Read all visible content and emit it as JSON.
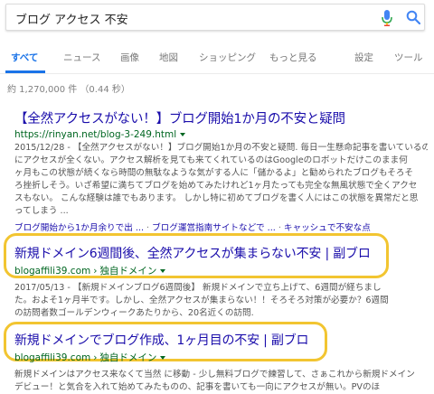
{
  "search": {
    "query": "ブログ アクセス 不安"
  },
  "tabs": [
    {
      "label": "すべて",
      "active": true
    },
    {
      "label": "ニュース"
    },
    {
      "label": "画像"
    },
    {
      "label": "地図"
    },
    {
      "label": "ショッピング"
    },
    {
      "label": "もっと見る"
    },
    {
      "label": "設定"
    },
    {
      "label": "ツール"
    }
  ],
  "stats": "約 1,270,000 件 （0.44 秒）",
  "results": [
    {
      "title": "【全然アクセスがない！】ブログ開始1か月の不安と疑問",
      "url": "https://rinyan.net/blog-3-249.html",
      "snippet": [
        "2015/12/28 - 【全然アクセスがない！】ブログ開始1か月の不安と疑問. 毎日一生懸命記事を書いているの",
        "にアクセスが全くない。アクセス解析を見ても来てくれているのはGoogleのロボットだけこのまま何",
        "ヶ月もこの状態が続くなら時間の無駄なような気がする人に「儲かるよ」と勧められたブログもそろそ",
        "ろ挫折しそう。いざ希望に満ちてブログを始めてみたけれど1ヶ月たっても完全な無風状態で全くアクセ",
        "スもない。 こんな経験は誰でもあります。 しかし特に初めてブログを書く人にはこの状態を異常だと思",
        "ってしまう ..."
      ],
      "sitelinks": [
        "ブログ開始から1か月余りで出 ...",
        "ブログ運営指南サイトなどで ...",
        "キャッシュで不安な点"
      ]
    },
    {
      "title": "新規ドメイン6週間後、全然アクセスが集まらない不安 | 副ブロ",
      "url": "blogaffili39.com",
      "breadcrumb": "独自ドメイン",
      "snippet": [
        "2017/05/13 - 【新規ドメインブログ6週間後】 新規ドメインで立ち上げて、6週間が経ちまし",
        "た。およそ1ヶ月半です。しかし、全然アクセスが集まらない！！そろそろ対策が必要か？6週間",
        "の訪問者数ゴールデンウィークあたりから、20名近くの訪問."
      ]
    },
    {
      "title": "新規ドメインでブログ作成、1ヶ月目の不安 | 副ブロ",
      "url": "blogaffili39.com",
      "breadcrumb": "独自ドメイン",
      "snippet": [
        "新規ドメインはアクセス来なくて当然 に移動 - 少し無料ブログで練習して、さぁこれから新規ドメイン",
        "デビュー！と気合を入れて始めてみたものの、記事を書いても一向にアクセスが無い。PVのほ"
      ]
    }
  ],
  "colors": {
    "highlight": "#f2c531",
    "link": "#1a0dab",
    "url": "#006621",
    "accent": "#1a73e8"
  }
}
